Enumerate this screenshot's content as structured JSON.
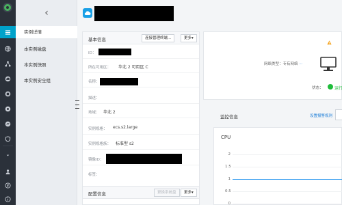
{
  "rail": {
    "icons": [
      "leaf-logo-icon",
      "menu-icon",
      "globe-icon",
      "network-icon",
      "cloud-icon",
      "storage-icon",
      "security-icon",
      "monitor-icon",
      "shield-icon",
      "collapse-icon",
      "person-icon",
      "currency-icon",
      "info-icon"
    ],
    "active": "menu-icon"
  },
  "subnav": {
    "back_glyph": "‹",
    "items": [
      "实例详情",
      "本实例磁盘",
      "本实例快照",
      "本实例安全组"
    ],
    "active_index": 0
  },
  "header": {
    "instance_name": null
  },
  "basic_info": {
    "title": "基本信息",
    "connect_button": "连接管理终端...",
    "more_button": "更多▾",
    "rows": [
      {
        "label": "ID：",
        "value": null
      },
      {
        "label": "所在可用区：",
        "value": "华北 2 可用区 C"
      },
      {
        "label": "名称：",
        "value": null
      },
      {
        "label": "描述：",
        "value": ""
      },
      {
        "label": "地域：",
        "value": "华北 2"
      },
      {
        "label": "实例规格：",
        "value": "ecs.s2.large"
      },
      {
        "label": "实例规格族：",
        "value": "标准型 s2"
      },
      {
        "label": "镜像ID：",
        "value": null
      },
      {
        "label": "标签：",
        "value": ""
      }
    ]
  },
  "config_info": {
    "title": "配置信息",
    "change_system_disk_button": "更换系统盘",
    "more_button": "更多▾"
  },
  "status": {
    "network_type_label": "网络类型：",
    "network_type_value": "专有网络",
    "more_glyph": "···",
    "state_label": "状态：",
    "state_value": "运行",
    "state_color": "#1fbd3b",
    "warning_color": "#f5a623"
  },
  "monitor": {
    "title": "监控信息",
    "alarm_link": "设置报警规则"
  },
  "chart_data": {
    "type": "line",
    "title": "CPU",
    "y_ticks": [
      "2",
      "1.5",
      "1",
      "0.5",
      "0"
    ],
    "series": [
      {
        "values": [
          1,
          1,
          1,
          1,
          1
        ]
      }
    ],
    "ylim": [
      0,
      2
    ],
    "grid": true,
    "series_color": "#3aa0f0"
  },
  "colors": {
    "rail_bg": "#2b313a",
    "rail_active": "#00a2ca",
    "accent_blue": "#1aa0e6",
    "link_blue": "#1f7fd8"
  }
}
